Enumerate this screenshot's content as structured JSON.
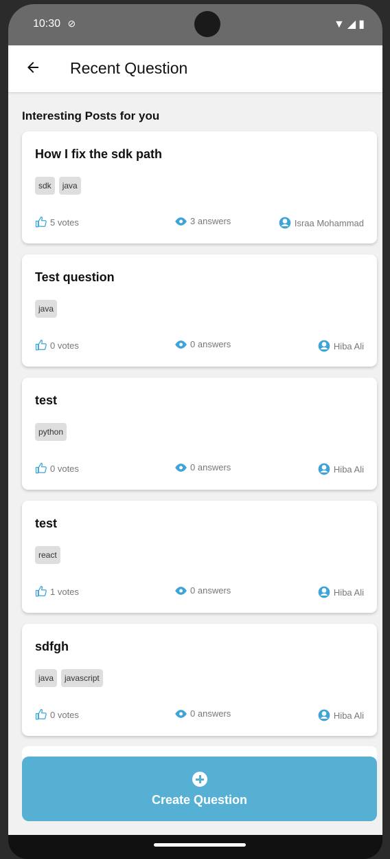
{
  "status_bar": {
    "time": "10:30"
  },
  "app_bar": {
    "title": "Recent Question"
  },
  "section_title": "Interesting Posts for you",
  "posts": [
    {
      "title": "How I fix the sdk path",
      "tags": [
        "sdk",
        "java"
      ],
      "votes": "5 votes",
      "answers": "3 answers",
      "author": "Israa Mohammad"
    },
    {
      "title": "Test question",
      "tags": [
        "java"
      ],
      "votes": "0 votes",
      "answers": "0 answers",
      "author": "Hiba Ali"
    },
    {
      "title": "test",
      "tags": [
        "python"
      ],
      "votes": "0 votes",
      "answers": "0 answers",
      "author": "Hiba Ali"
    },
    {
      "title": "test",
      "tags": [
        "react"
      ],
      "votes": "1 votes",
      "answers": "0 answers",
      "author": "Hiba Ali"
    },
    {
      "title": "sdfgh",
      "tags": [
        "java",
        "javascript"
      ],
      "votes": "0 votes",
      "answers": "0 answers",
      "author": "Hiba Ali"
    }
  ],
  "create_button": {
    "label": "Create Question"
  },
  "colors": {
    "accent": "#56b0d3",
    "icon_blue": "#3ea4d8"
  }
}
